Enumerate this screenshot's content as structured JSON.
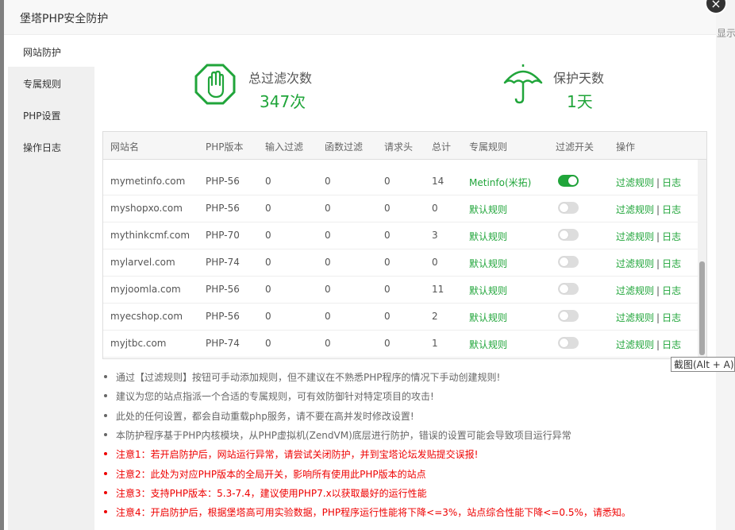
{
  "window": {
    "title": "堡塔PHP安全防护",
    "close_symbol": "×",
    "background_text": "显示"
  },
  "sidebar": {
    "items": [
      {
        "label": "网站防护",
        "active": true
      },
      {
        "label": "专属规则",
        "active": false
      },
      {
        "label": "PHP设置",
        "active": false
      },
      {
        "label": "操作日志",
        "active": false
      }
    ]
  },
  "stats": {
    "filter": {
      "label": "总过滤次数",
      "value": "347次",
      "icon": "stop-hand-icon"
    },
    "protect": {
      "label": "保护天数",
      "value": "1天",
      "icon": "umbrella-icon"
    }
  },
  "table": {
    "headers": [
      "网站名",
      "PHP版本",
      "输入过滤",
      "函数过滤",
      "请求头",
      "总计",
      "专属规则",
      "过滤开关",
      "操作"
    ],
    "rows": [
      {
        "site": "mymetinfo.com",
        "php": "PHP-56",
        "input": "0",
        "func": "0",
        "header": "0",
        "total": "14",
        "rule": "Metinfo(米拓)",
        "enabled": true
      },
      {
        "site": "myshopxo.com",
        "php": "PHP-56",
        "input": "0",
        "func": "0",
        "header": "0",
        "total": "0",
        "rule": "默认规则",
        "enabled": false
      },
      {
        "site": "mythinkcmf.com",
        "php": "PHP-70",
        "input": "0",
        "func": "0",
        "header": "0",
        "total": "3",
        "rule": "默认规则",
        "enabled": false
      },
      {
        "site": "mylarvel.com",
        "php": "PHP-74",
        "input": "0",
        "func": "0",
        "header": "0",
        "total": "0",
        "rule": "默认规则",
        "enabled": false
      },
      {
        "site": "myjoomla.com",
        "php": "PHP-56",
        "input": "0",
        "func": "0",
        "header": "0",
        "total": "11",
        "rule": "默认规则",
        "enabled": false
      },
      {
        "site": "myecshop.com",
        "php": "PHP-56",
        "input": "0",
        "func": "0",
        "header": "0",
        "total": "2",
        "rule": "默认规则",
        "enabled": false
      },
      {
        "site": "myjtbc.com",
        "php": "PHP-74",
        "input": "0",
        "func": "0",
        "header": "0",
        "total": "1",
        "rule": "默认规则",
        "enabled": false
      }
    ],
    "action_filter_label": "过滤规则",
    "action_separator": "|",
    "action_log_label": "日志"
  },
  "tooltip": "截图(Alt + A)",
  "notes": [
    {
      "text": "通过【过滤规则】按钮可手动添加规则，但不建议在不熟悉PHP程序的情况下手动创建规则!",
      "warn": false
    },
    {
      "text": "建议为您的站点指派一个合适的专属规则，可有效防御针对特定项目的攻击!",
      "warn": false
    },
    {
      "text": "此处的任何设置，都会自动重载php服务，请不要在高并发时修改设置!",
      "warn": false
    },
    {
      "text": "本防护程序基于PHP内核模块，从PHP虚拟机(ZendVM)底层进行防护，错误的设置可能会导致项目运行异常",
      "warn": false
    },
    {
      "text": "注意1：若开启防护后，网站运行异常，请尝试关闭防护，并到宝塔论坛发贴提交误报!",
      "warn": true
    },
    {
      "text": "注意2：此处为对应PHP版本的全局开关，影响所有使用此PHP版本的站点",
      "warn": true
    },
    {
      "text": "注意3：支持PHP版本：5.3-7.4，建议使用PHP7.x以获取最好的运行性能",
      "warn": true
    },
    {
      "text": "注意4：开启防护后，根据堡塔高可用实验数据，PHP程序运行性能将下降<=3%，站点综合性能下降<=0.5%，请悉知。",
      "warn": true
    }
  ],
  "colors": {
    "accent": "#20a53a",
    "warning": "#ee0000"
  }
}
